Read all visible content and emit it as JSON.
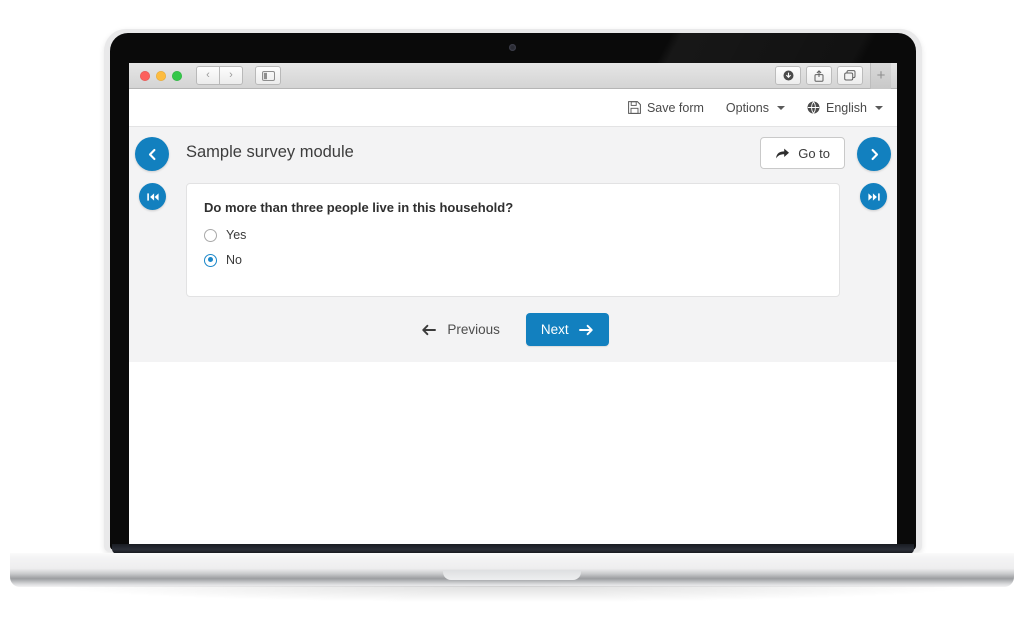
{
  "browser": {
    "traffic_lights": [
      "close-red",
      "minimize-yellow",
      "maximize-green"
    ],
    "back_glyph": "‹",
    "forward_glyph": "›",
    "sidebar_icon": "sidebar-toggle-icon",
    "right_icons": [
      "download-icon",
      "share-icon",
      "tabs-icon"
    ],
    "new_tab_glyph": "+"
  },
  "topnav": {
    "save_label": "Save form",
    "save_icon": "floppy-disk-icon",
    "options_label": "Options",
    "language_label": "English",
    "language_icon": "globe-icon"
  },
  "module": {
    "title": "Sample survey module",
    "goto_label": "Go to",
    "goto_icon": "share-arrow-icon",
    "prev_module_icon": "chevron-left-icon",
    "next_module_icon": "chevron-right-icon",
    "first_module_icon": "skip-to-start-icon",
    "last_module_icon": "skip-to-end-icon"
  },
  "question": {
    "text": "Do more than three people live in this household?",
    "options": [
      {
        "label": "Yes",
        "selected": false
      },
      {
        "label": "No",
        "selected": true
      }
    ]
  },
  "form_nav": {
    "previous_label": "Previous",
    "previous_icon": "arrow-left-icon",
    "next_label": "Next",
    "next_icon": "arrow-right-icon"
  },
  "colors": {
    "accent": "#1280bf",
    "radio_selected": "#1b87c9",
    "panel_bg": "#f3f3f4",
    "card_bg": "#ffffff"
  }
}
